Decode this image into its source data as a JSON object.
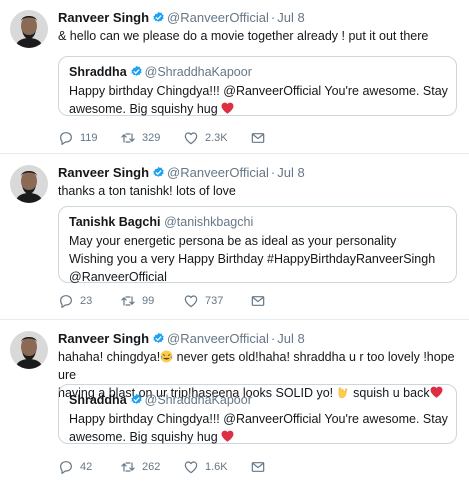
{
  "tweets": [
    {
      "name": "Ranveer Singh",
      "handle": "@RanveerOfficial",
      "time": "Jul 8",
      "text": "& hello can we please do a movie together already ! put it out there",
      "quote": {
        "name": "Shraddha",
        "handle": "@ShraddhaKapoor",
        "line1": "Happy birthday Chingdya!!! @RanveerOfficial You're awesome. Stay",
        "line2": "awesome. Big squishy hug"
      },
      "replies": "119",
      "retweets": "329",
      "likes": "2.3K"
    },
    {
      "name": "Ranveer Singh",
      "handle": "@RanveerOfficial",
      "time": "Jul 8",
      "text": "thanks a ton tanishk! lots of love",
      "quote": {
        "name": "Tanishk Bagchi",
        "handle": "@tanishkbagchi",
        "line1": "May your energetic persona be as ideal as your personality",
        "line2": "Wishing you a very Happy Birthday #HappyBirthdayRanveerSingh",
        "line3": "@RanveerOfficial"
      },
      "replies": "23",
      "retweets": "99",
      "likes": "737"
    },
    {
      "name": "Ranveer Singh",
      "handle": "@RanveerOfficial",
      "time": "Jul 8",
      "line1": "hahaha! chingdya!",
      "line1b": " never gets old!haha! shraddha u r too lovely !hope ure",
      "line2": "having a blast on ur trip!haseena looks SOLID yo!",
      "line2b": " squish u back",
      "quote": {
        "name": "Shraddha",
        "handle": "@ShraddhaKapoor",
        "line1": "Happy birthday Chingdya!!! @RanveerOfficial You're awesome. Stay",
        "line2": "awesome. Big squishy hug"
      },
      "replies": "42",
      "retweets": "262",
      "likes": "1.6K"
    }
  ],
  "separator": "·",
  "icons": {
    "verified": "verified-badge-icon",
    "reply": "reply-icon",
    "retweet": "retweet-icon",
    "like": "like-icon",
    "dm": "direct-message-icon",
    "heart_emoji": "red-heart-emoji",
    "laugh_emoji": "tears-of-joy-emoji",
    "horns_emoji": "sign-of-horns-emoji"
  },
  "colors": {
    "verified": "#1da1f2",
    "muted": "#657786",
    "border": "#ccd6dd",
    "heart": "#e0245e"
  }
}
